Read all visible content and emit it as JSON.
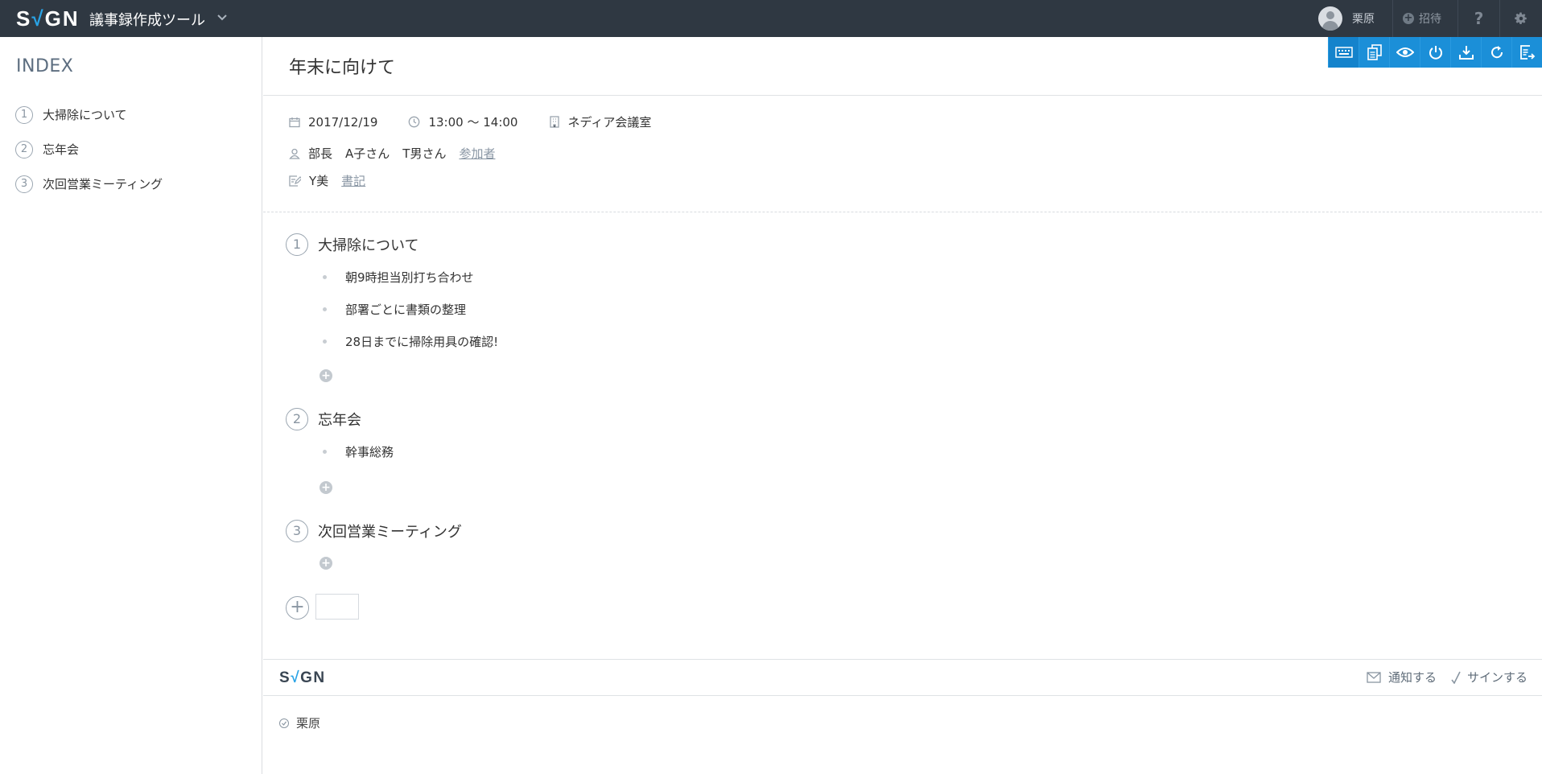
{
  "header": {
    "logo_left": "S",
    "logo_check": "√",
    "logo_right": "GN",
    "app_title": "議事録作成ツール",
    "user_name": "栗原",
    "invite_label": "招待",
    "help_label": "?"
  },
  "toolbar": {
    "icons": [
      "keyboard-icon",
      "copy-document-icon",
      "eye-icon",
      "power-icon",
      "download-icon",
      "refresh-icon",
      "export-icon"
    ]
  },
  "sidebar": {
    "title": "INDEX",
    "items": [
      {
        "num": "1",
        "label": "大掃除について"
      },
      {
        "num": "2",
        "label": "忘年会"
      },
      {
        "num": "3",
        "label": "次回営業ミーティング"
      }
    ]
  },
  "doc": {
    "title": "年末に向けて",
    "date": "2017/12/19",
    "time": "13:00 〜 14:00",
    "room": "ネディア会議室",
    "attendees": [
      "部長",
      "A子さん",
      "T男さん"
    ],
    "attendees_link": "参加者",
    "recorder": "Y美",
    "recorder_link": "書記"
  },
  "agenda": [
    {
      "num": "1",
      "title": "大掃除について",
      "bullets": [
        "朝9時担当別打ち合わせ",
        "部署ごとに書類の整理",
        "28日までに掃除用具の確認!"
      ]
    },
    {
      "num": "2",
      "title": "忘年会",
      "bullets": [
        "幹事総務"
      ]
    },
    {
      "num": "3",
      "title": "次回営業ミーティング",
      "bullets": []
    }
  ],
  "add_agenda": {
    "symbol": "+",
    "input_value": ""
  },
  "footer": {
    "logo_left": "S",
    "logo_check": "√",
    "logo_right": "GN",
    "notify_label": "通知する",
    "sign_label": "サインする",
    "signer": "栗原"
  },
  "colors": {
    "topbar": "#2f3842",
    "toolbar": "#1b8fd8",
    "accent": "#29a3e6"
  }
}
